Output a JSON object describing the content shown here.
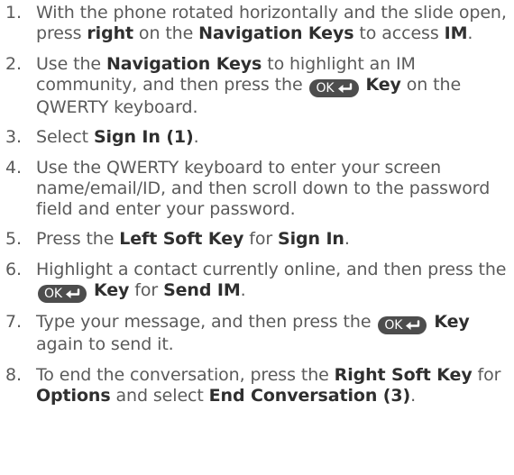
{
  "ok_key": {
    "label": "OK",
    "icon": "enter-arrow-icon",
    "color": "#4d4d4d"
  },
  "steps": [
    {
      "number": "1.",
      "parts": [
        {
          "t": "With the phone rotated horizontally and the slide open, press "
        },
        {
          "t": "right",
          "bold": true
        },
        {
          "t": " on the "
        },
        {
          "t": "Navigation Keys",
          "bold": true
        },
        {
          "t": " to access "
        },
        {
          "t": "IM",
          "bold": true
        },
        {
          "t": "."
        }
      ]
    },
    {
      "number": "2.",
      "parts": [
        {
          "t": "Use the "
        },
        {
          "t": "Navigation Keys",
          "bold": true
        },
        {
          "t": " to highlight an IM community, and then press the "
        },
        {
          "key": "ok"
        },
        {
          "t": " "
        },
        {
          "t": "Key",
          "bold": true
        },
        {
          "t": " on the QWERTY keyboard."
        }
      ]
    },
    {
      "number": "3.",
      "parts": [
        {
          "t": "Select "
        },
        {
          "t": "Sign In (1)",
          "bold": true
        },
        {
          "t": "."
        }
      ]
    },
    {
      "number": "4.",
      "parts": [
        {
          "t": "Use the QWERTY keyboard to enter your screen name/email/ID, and then scroll down to the password field and enter your password."
        }
      ]
    },
    {
      "number": "5.",
      "parts": [
        {
          "t": "Press the "
        },
        {
          "t": "Left Soft Key",
          "bold": true
        },
        {
          "t": " for "
        },
        {
          "t": "Sign In",
          "bold": true
        },
        {
          "t": "."
        }
      ]
    },
    {
      "number": "6.",
      "parts": [
        {
          "t": "Highlight a contact currently online, and then press the "
        },
        {
          "key": "ok"
        },
        {
          "t": " "
        },
        {
          "t": "Key",
          "bold": true
        },
        {
          "t": " for "
        },
        {
          "t": "Send IM",
          "bold": true
        },
        {
          "t": "."
        }
      ]
    },
    {
      "number": "7.",
      "parts": [
        {
          "t": "Type your message, and then press the "
        },
        {
          "key": "ok"
        },
        {
          "t": " "
        },
        {
          "t": "Key",
          "bold": true
        },
        {
          "t": " again to send it."
        }
      ]
    },
    {
      "number": "8.",
      "parts": [
        {
          "t": "To end the conversation, press the "
        },
        {
          "t": "Right Soft Key",
          "bold": true
        },
        {
          "t": " for "
        },
        {
          "t": "Options",
          "bold": true
        },
        {
          "t": " and select "
        },
        {
          "t": "End Conversation (3)",
          "bold": true
        },
        {
          "t": "."
        }
      ]
    }
  ]
}
